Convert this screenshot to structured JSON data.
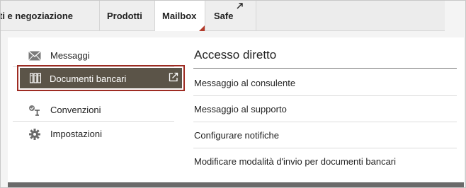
{
  "nav": {
    "tabs": [
      {
        "label": "ti e negoziazione"
      },
      {
        "label": "Prodotti"
      },
      {
        "label": "Mailbox"
      },
      {
        "label": "Safe"
      }
    ]
  },
  "menu": {
    "items": [
      {
        "label": "Messaggi",
        "icon": "envelope-icon"
      },
      {
        "label": "Documenti bancari",
        "icon": "documents-icon",
        "selected": true
      },
      {
        "label": "Convenzioni",
        "icon": "agreements-icon"
      },
      {
        "label": "Impostazioni",
        "icon": "gear-icon"
      }
    ]
  },
  "quick_access": {
    "title": "Accesso diretto",
    "links": [
      {
        "label": "Messaggio al consulente"
      },
      {
        "label": "Messaggio al supporto"
      },
      {
        "label": "Configurare notifiche"
      },
      {
        "label": "Modificare modalità d'invio per documenti bancari"
      }
    ]
  },
  "colors": {
    "accent": "#9e2b22",
    "selected_bg": "#5b5448",
    "panel_footer": "#6a6a6a"
  }
}
